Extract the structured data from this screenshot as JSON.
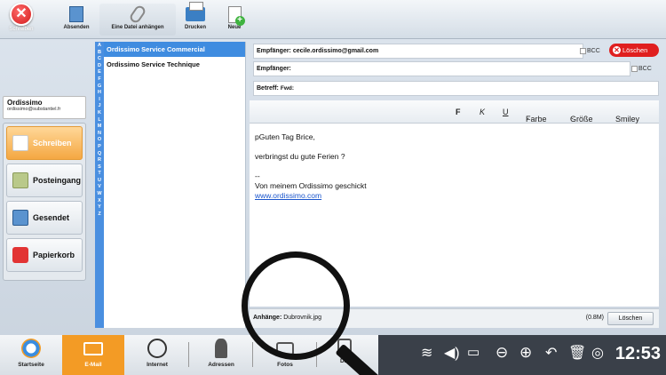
{
  "toolbar": {
    "close_label": "Schreiben",
    "buttons": [
      {
        "label": "Absenden",
        "icon": "send-icon"
      },
      {
        "label": "Eine Datei anhängen",
        "icon": "paperclip-icon"
      },
      {
        "label": "Drucken",
        "icon": "printer-icon"
      },
      {
        "label": "Neue",
        "icon": "new-document-icon"
      }
    ]
  },
  "account": {
    "name": "Ordissimo",
    "email": "ordissimo@substantiel.fr"
  },
  "sidebar": {
    "items": [
      {
        "label": "Schreiben",
        "active": true
      },
      {
        "label": "Posteingang"
      },
      {
        "label": "Gesendet"
      },
      {
        "label": "Papierkorb"
      }
    ]
  },
  "alphabet": [
    "A",
    "B",
    "C",
    "D",
    "E",
    "F",
    "G",
    "H",
    "I",
    "J",
    "K",
    "L",
    "M",
    "N",
    "O",
    "P",
    "Q",
    "R",
    "S",
    "T",
    "U",
    "V",
    "W",
    "X",
    "Y",
    "Z"
  ],
  "contacts": [
    "Ordissimo Service Commercial",
    "Ordissimo Service Technique"
  ],
  "compose": {
    "to_label": "Empfänger:",
    "to_value": "cecile.ordissimo@gmail.com",
    "cc_label": "Empfänger:",
    "bcc_label": "BCC",
    "delete_label": "Löschen",
    "subject_label": "Betreff:",
    "subject_value": "Fwd:",
    "format": {
      "bold": "F",
      "italic": "K",
      "underline": "U",
      "color": "Farbe",
      "size": "Größe",
      "smiley": "Smiley"
    },
    "body": {
      "line1": "pGuten Tag Brice,",
      "line2": "verbringst du gute Ferien ?",
      "line3": "--",
      "line4": "Von meinem Ordissimo geschickt",
      "link": "www.ordissimo.com"
    },
    "attachment_label": "Anhänge:",
    "attachment_file": "Dubrovnik.jpg",
    "attachment_size": "(0.8M)",
    "attachment_remove": "Löschen"
  },
  "dock": {
    "items": [
      {
        "label": "Startseite"
      },
      {
        "label": "E-Mail",
        "active": true
      },
      {
        "label": "Internet"
      },
      {
        "label": "Adressen"
      },
      {
        "label": "Fotos"
      },
      {
        "label": "D..."
      }
    ]
  },
  "status": {
    "time": "12:53"
  },
  "colors": {
    "accent": "#f39b25",
    "selection": "#3f8ce0",
    "delete": "#e01f1f"
  }
}
